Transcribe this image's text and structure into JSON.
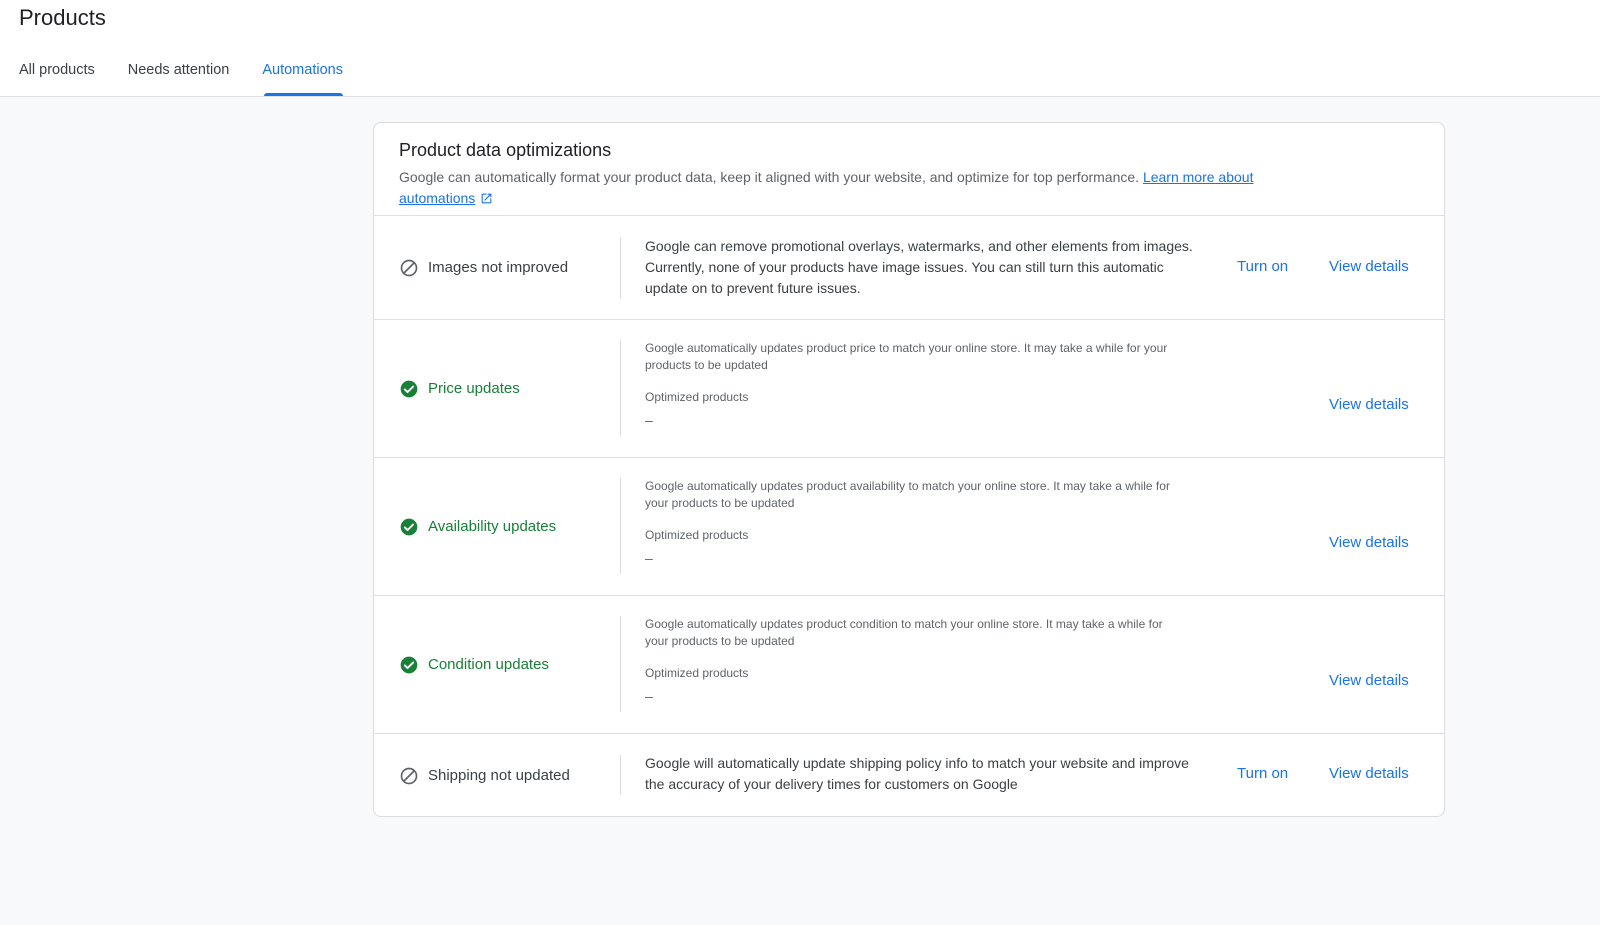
{
  "header": {
    "title": "Products",
    "tabs": [
      {
        "label": "All products"
      },
      {
        "label": "Needs attention"
      },
      {
        "label": "Automations"
      }
    ]
  },
  "card": {
    "title": "Product data optimizations",
    "description": "Google can automatically format your product data, keep it aligned with your website, and optimize for top performance.",
    "learn_more_part1": "Learn more about",
    "learn_more_part2": "automations"
  },
  "rows": [
    {
      "label": "Images not improved",
      "status": "off",
      "text": "Google can remove promotional overlays, watermarks, and other elements from images. Currently, none of your products have image issues. You can still turn this automatic update on to prevent future issues.",
      "turn_on": "Turn on",
      "view_details": "View details"
    },
    {
      "label": "Price updates",
      "status": "on",
      "text": "Google automatically updates product price to match your online store. It may take a while for your products to be updated",
      "optimized_label": "Optimized products",
      "optimized_value": "–",
      "view_details": "View details"
    },
    {
      "label": "Availability updates",
      "status": "on",
      "text": "Google automatically updates product availability to match your online store. It may take a while for your products to be updated",
      "optimized_label": "Optimized products",
      "optimized_value": "–",
      "view_details": "View details"
    },
    {
      "label": "Condition updates",
      "status": "on",
      "text": "Google automatically updates product condition to match your online store. It may take a while for your products to be updated",
      "optimized_label": "Optimized products",
      "optimized_value": "–",
      "view_details": "View details"
    },
    {
      "label": "Shipping not updated",
      "status": "off",
      "text": "Google will automatically update shipping policy info to match your website and improve the accuracy of your delivery times for customers on Google",
      "turn_on": "Turn on",
      "view_details": "View details"
    }
  ],
  "colors": {
    "accent": "#1a73e8",
    "success": "#188038",
    "background": "#f8f9fa"
  }
}
